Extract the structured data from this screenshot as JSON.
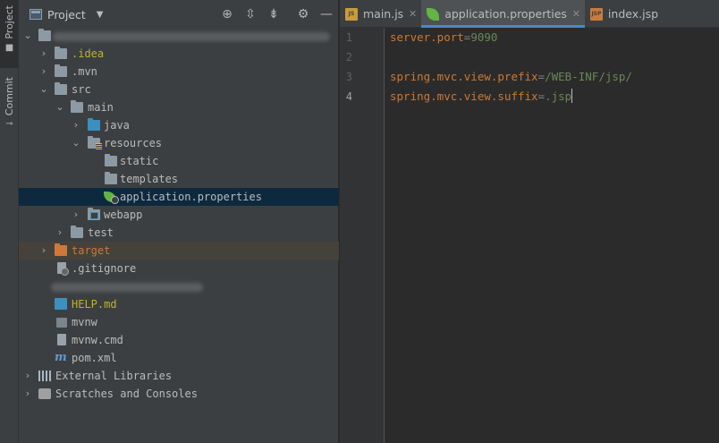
{
  "side_strip": {
    "project_label": "Project",
    "commit_label": "Commit"
  },
  "project_panel": {
    "title": "Project",
    "tree": [
      {
        "label": "",
        "redacted": true
      },
      {
        "label": ".idea",
        "color": "#bbb529"
      },
      {
        "label": ".mvn"
      },
      {
        "label": "src"
      },
      {
        "label": "main"
      },
      {
        "label": "java"
      },
      {
        "label": "resources"
      },
      {
        "label": "static"
      },
      {
        "label": "templates"
      },
      {
        "label": "application.properties",
        "selected": true
      },
      {
        "label": "webapp"
      },
      {
        "label": "test"
      },
      {
        "label": "target",
        "color": "#d0783a"
      },
      {
        "label": ".gitignore"
      },
      {
        "label": "",
        "redacted": true
      },
      {
        "label": "HELP.md",
        "color": "#bbb529"
      },
      {
        "label": "mvnw"
      },
      {
        "label": "mvnw.cmd"
      },
      {
        "label": "pom.xml"
      },
      {
        "label": "External Libraries"
      },
      {
        "label": "Scratches and Consoles"
      }
    ]
  },
  "editor_tabs": [
    {
      "label": "main.js",
      "icon": "js-file-icon"
    },
    {
      "label": "application.properties",
      "icon": "spring-properties-icon",
      "active": true
    },
    {
      "label": "index.jsp",
      "icon": "jsp-file-icon"
    }
  ],
  "editor": {
    "lines": [
      {
        "num": "1",
        "key": "server.port",
        "eq": "=",
        "value": "9090"
      },
      {
        "num": "2",
        "key": "",
        "eq": "",
        "value": ""
      },
      {
        "num": "3",
        "key": "spring.mvc.view.prefix",
        "eq": "=",
        "value": "/WEB-INF/jsp/"
      },
      {
        "num": "4",
        "key": "spring.mvc.view.suffix",
        "eq": "=",
        "value": ".jsp"
      }
    ],
    "current_line": "4"
  },
  "colors": {
    "selection": "#0d293e",
    "excluded_row": "#45423b",
    "active_tab_underline": "#4a88c7",
    "property_key": "#cc7832",
    "property_value": "#6a8759"
  }
}
